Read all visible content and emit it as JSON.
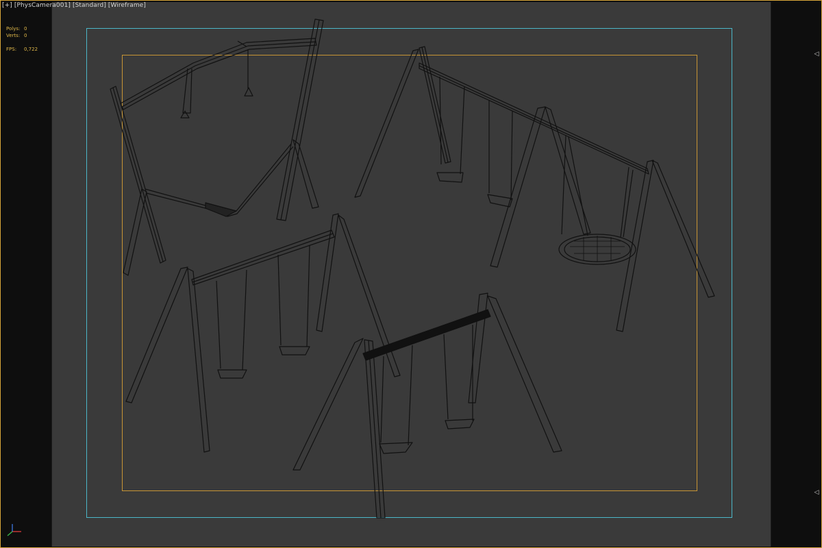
{
  "viewport": {
    "label_parts": [
      "[+]",
      "[PhysCamera001]",
      "[Standard]",
      "[Wireframe]"
    ],
    "stats": {
      "polys_label": "Polys:",
      "polys_value": "0",
      "verts_label": "Verts:",
      "verts_value": "0",
      "fps_label": "FPS:",
      "fps_value": "0,722"
    }
  },
  "colors": {
    "viewport_bg": "#3a3a3a",
    "frame": "#d8a63a",
    "safe_frame": "#4cb7c9",
    "render_region": "#c89635",
    "stats_text": "#e0b84a",
    "wire": "#111111"
  },
  "icons": {
    "right_handles": [
      "triangle-left-icon",
      "triangle-left-icon"
    ],
    "axis": "axis-tripod-icon"
  }
}
